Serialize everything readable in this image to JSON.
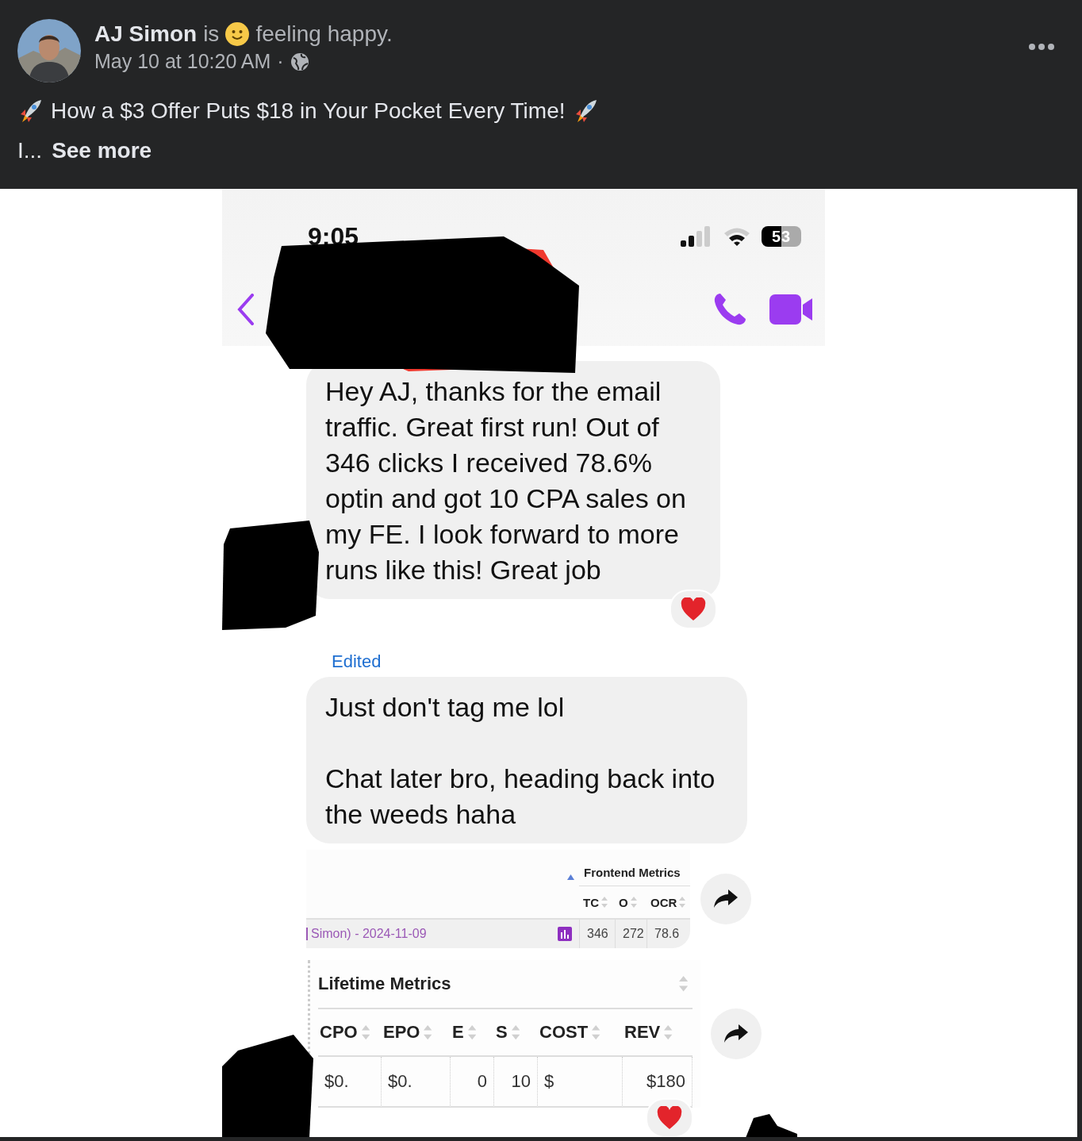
{
  "post": {
    "author": "AJ Simon",
    "verb": "is",
    "feeling": "feeling happy.",
    "date": "May 10 at 10:20 AM",
    "separator": "·",
    "headline": "How a $3 Offer Puts $18 in Your Pocket Every Time!",
    "excerpt": "I...",
    "see_more": "See more"
  },
  "phone": {
    "time": "9:05",
    "battery": "53"
  },
  "messages": [
    {
      "kind": "text",
      "paragraphs": [
        "Hey AJ, thanks for the email traffic. Great first run! Out of 346 clicks I received 78.6% optin and got 10 CPA sales on my FE. I look forward to more runs like this! Great job"
      ],
      "hearted": true
    },
    {
      "kind": "text",
      "label_above": "Edited",
      "paragraphs": [
        "Just don't tag me lol",
        "Chat later bro, heading back into the weeds haha"
      ],
      "hearted": false
    },
    {
      "kind": "grouped_table",
      "title": "Frontend Metrics",
      "columns": [
        "TC",
        "O",
        "OCR"
      ],
      "rows": [
        {
          "label": "Simon) - 2024-11-09",
          "cells": [
            "346",
            "272",
            "78.6"
          ]
        }
      ],
      "hearted": false
    },
    {
      "kind": "table",
      "title": "Lifetime Metrics",
      "columns": [
        "CPO",
        "EPO",
        "E",
        "S",
        "COST",
        "REV"
      ],
      "rows": [
        {
          "cells": [
            "$0.",
            "$0.",
            "0",
            "10",
            "$",
            "$180"
          ]
        }
      ],
      "hearted": true
    }
  ]
}
